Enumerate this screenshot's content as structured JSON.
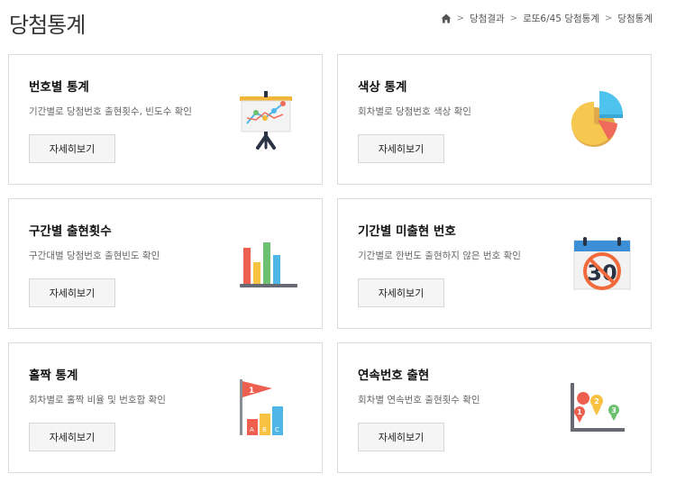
{
  "page_title": "당첨통계",
  "breadcrumb": {
    "home_icon": "home-icon",
    "items": [
      "당첨결과",
      "로또6/45 당첨통계",
      "당첨통계"
    ]
  },
  "cards": [
    {
      "title": "번호별 통계",
      "desc": "기간별로 당첨번호 출현횟수, 빈도수 확인",
      "button": "자세히보기",
      "icon": "presentation-chart-icon"
    },
    {
      "title": "색상 통계",
      "desc": "회차별로 당첨번호 색상 확인",
      "button": "자세히보기",
      "icon": "pie-chart-icon"
    },
    {
      "title": "구간별 출현횟수",
      "desc": "구간대별 당첨번호 출현빈도 확인",
      "button": "자세히보기",
      "icon": "bar-chart-icon"
    },
    {
      "title": "기간별 미출현 번호",
      "desc": "기간별로 한번도 출현하지 않은 번호 확인",
      "button": "자세히보기",
      "icon": "calendar-no-30-icon"
    },
    {
      "title": "홀짝 통계",
      "desc": "회차별로 홀짝 비율 및 번호합 확인",
      "button": "자세히보기",
      "icon": "flag-bar-chart-icon"
    },
    {
      "title": "연속번호 출현",
      "desc": "회차별 연속번호 출현횟수 확인",
      "button": "자세히보기",
      "icon": "map-pin-chart-icon"
    }
  ]
}
